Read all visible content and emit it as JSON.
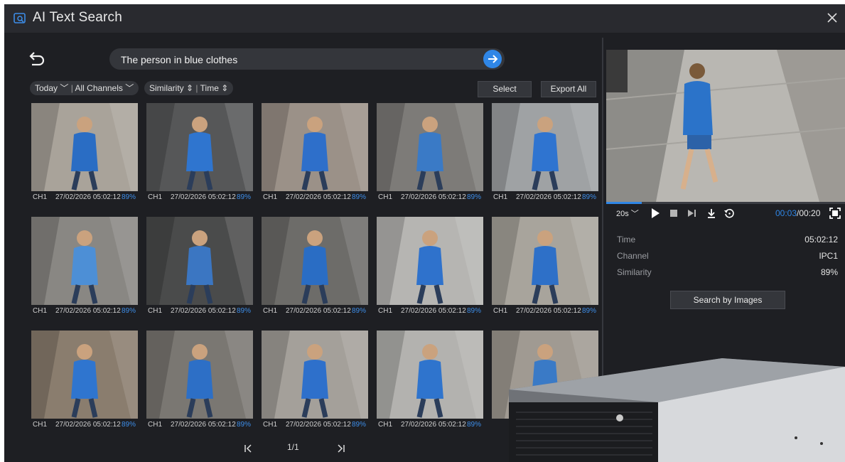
{
  "app": {
    "title": "AI Text Search"
  },
  "search": {
    "query": "The person in blue clothes"
  },
  "filters": {
    "date": "Today",
    "channels": "All Channels",
    "sort_similarity": "Similarity",
    "sort_time": "Time"
  },
  "toolbar": {
    "select_label": "Select",
    "export_label": "Export All"
  },
  "results": [
    {
      "channel": "CH1",
      "timestamp": "27/02/2026 05:02:12",
      "similarity": "89%"
    },
    {
      "channel": "CH1",
      "timestamp": "27/02/2026 05:02:12",
      "similarity": "89%"
    },
    {
      "channel": "CH1",
      "timestamp": "27/02/2026 05:02:12",
      "similarity": "89%"
    },
    {
      "channel": "CH1",
      "timestamp": "27/02/2026 05:02:12",
      "similarity": "89%"
    },
    {
      "channel": "CH1",
      "timestamp": "27/02/2026 05:02:12",
      "similarity": "89%"
    },
    {
      "channel": "CH1",
      "timestamp": "27/02/2026 05:02:12",
      "similarity": "89%"
    },
    {
      "channel": "CH1",
      "timestamp": "27/02/2026 05:02:12",
      "similarity": "89%"
    },
    {
      "channel": "CH1",
      "timestamp": "27/02/2026 05:02:12",
      "similarity": "89%"
    },
    {
      "channel": "CH1",
      "timestamp": "27/02/2026 05:02:12",
      "similarity": "89%"
    },
    {
      "channel": "CH1",
      "timestamp": "27/02/2026 05:02:12",
      "similarity": "89%"
    },
    {
      "channel": "CH1",
      "timestamp": "27/02/2026 05:02:12",
      "similarity": "89%"
    },
    {
      "channel": "CH1",
      "timestamp": "27/02/2026 05:02:12",
      "similarity": "89%"
    },
    {
      "channel": "CH1",
      "timestamp": "27/02/2026 05:02:12",
      "similarity": "89%"
    },
    {
      "channel": "CH1",
      "timestamp": "27/02/2026 05:02:12",
      "similarity": "89%"
    },
    {
      "channel": "",
      "timestamp": "",
      "similarity": ""
    }
  ],
  "pagination": {
    "page": "1/1"
  },
  "player": {
    "clip_length": "20s",
    "current_time": "00:03",
    "total_time": "/00:20",
    "progress": 0.15
  },
  "details": {
    "time_label": "Time",
    "time_value": "05:02:12",
    "channel_label": "Channel",
    "channel_value": "IPC1",
    "similarity_label": "Similarity",
    "similarity_value": "89%"
  },
  "search_by_images": "Search by Images",
  "colors": {
    "accent": "#2f86e6",
    "background": "#1e1f23",
    "panel": "#34363b"
  }
}
